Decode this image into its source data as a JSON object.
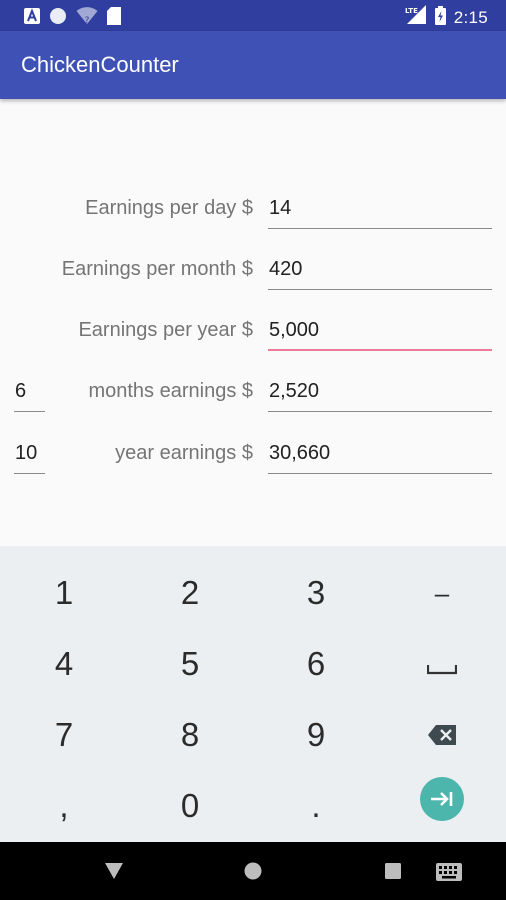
{
  "status_bar": {
    "left_icons": [
      "a-notification-icon",
      "circle-notification-icon",
      "wifi-unknown-icon",
      "sd-card-icon"
    ],
    "right_icons": [
      "lte-signal-icon",
      "battery-charging-icon"
    ],
    "lte_label": "LTE",
    "time": "2:15"
  },
  "app_bar": {
    "title": "ChickenCounter"
  },
  "form": {
    "rows": [
      {
        "label": "Earnings per day $",
        "value": "14",
        "focused": false
      },
      {
        "label": "Earnings per month $",
        "value": "420",
        "focused": false
      },
      {
        "label": "Earnings per year $",
        "value": "5,000",
        "focused": true
      },
      {
        "label": "months earnings $",
        "value": "2,520",
        "count": "6"
      },
      {
        "label": "year earnings $",
        "value": "30,660",
        "count": "10"
      }
    ]
  },
  "keyboard": {
    "row1": [
      "1",
      "2",
      "3",
      "–"
    ],
    "row2": [
      "4",
      "5",
      "6"
    ],
    "row3": [
      "7",
      "8",
      "9"
    ],
    "row4": [
      ",",
      "0",
      "."
    ],
    "special_icons": [
      "space-key-icon",
      "backspace-icon",
      "tab-next-icon"
    ]
  },
  "nav_bar": {
    "icons": [
      "back-triangle-icon",
      "home-circle-icon",
      "recents-square-icon",
      "keyboard-switch-icon"
    ]
  },
  "colors": {
    "status_bar": "#303F9F",
    "app_bar": "#3F51B5",
    "focus_underline": "#EE7A99",
    "tab_key": "#4DB6AC",
    "keyboard_bg": "#ECEFF1"
  }
}
